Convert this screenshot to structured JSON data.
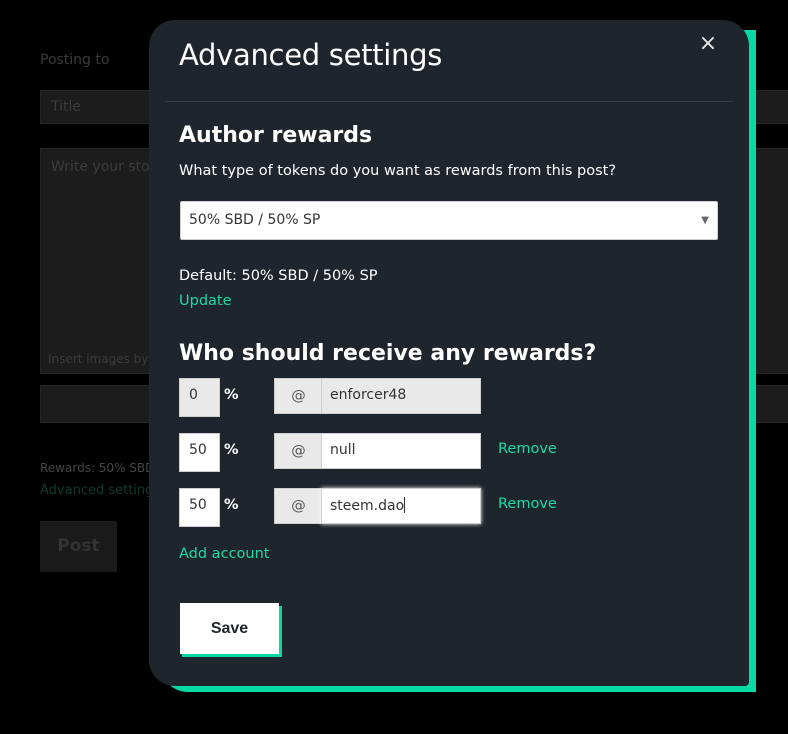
{
  "background": {
    "posting_to": "Posting to",
    "title_placeholder": "Title",
    "body_placeholder": "Write your story...",
    "insert_images": "Insert images by d",
    "rewards": "Rewards: 50% SBD",
    "advanced_settings": "Advanced settings",
    "post_button": "Post"
  },
  "modal": {
    "title": "Advanced settings",
    "close_icon": "×"
  },
  "author_rewards": {
    "heading": "Author rewards",
    "question": "What type of tokens do you want as rewards from this post?",
    "selected": "50% SBD / 50% SP",
    "default": "Default: 50% SBD / 50% SP",
    "update_link": "Update"
  },
  "beneficiaries": {
    "heading": "Who should receive any rewards?",
    "percent_sign": "%",
    "at_sign": "@",
    "rows": [
      {
        "percent": "0",
        "account": "enforcer48",
        "remove": ""
      },
      {
        "percent": "50",
        "account": "null",
        "remove": "Remove"
      },
      {
        "percent": "50",
        "account": "steem.dao",
        "remove": "Remove"
      }
    ],
    "add_account": "Add account"
  },
  "save_button": "Save",
  "colors": {
    "accent": "#07d9a5",
    "link": "#1adaa8",
    "modal_bg": "#1f252c"
  }
}
